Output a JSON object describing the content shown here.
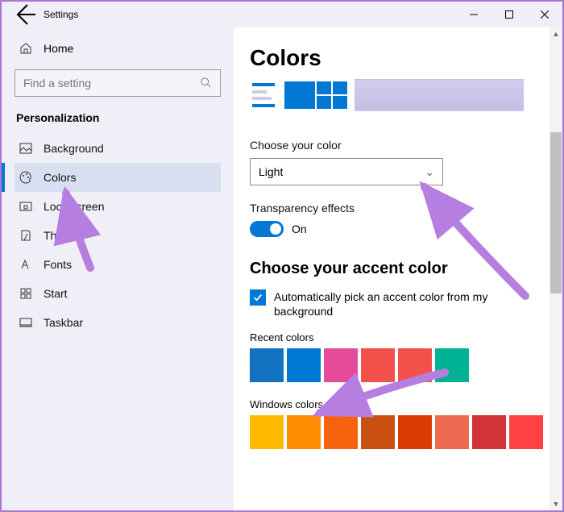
{
  "titlebar": {
    "title": "Settings"
  },
  "sidebar": {
    "home": "Home",
    "search_placeholder": "Find a setting",
    "category": "Personalization",
    "items": [
      {
        "label": "Background"
      },
      {
        "label": "Colors"
      },
      {
        "label": "Lock screen"
      },
      {
        "label": "Themes"
      },
      {
        "label": "Fonts"
      },
      {
        "label": "Start"
      },
      {
        "label": "Taskbar"
      }
    ]
  },
  "main": {
    "heading": "Colors",
    "choose_color_label": "Choose your color",
    "choose_color_value": "Light",
    "transparency_label": "Transparency effects",
    "transparency_state": "On",
    "accent_heading": "Choose your accent color",
    "auto_checkbox": "Automatically pick an accent color from my background",
    "recent_label": "Recent colors",
    "recent_colors": [
      "#1272c2",
      "#0078d4",
      "#e64a9a",
      "#f25048",
      "#f25048",
      "#00b294"
    ],
    "windows_label": "Windows colors",
    "windows_colors": [
      "#ffb900",
      "#ff8c00",
      "#f7630c",
      "#ca5010",
      "#da3b01",
      "#ef6950",
      "#d13438",
      "#ff4343"
    ]
  },
  "colors": {
    "accent": "#0078d4",
    "annotation": "#b57ee0"
  }
}
